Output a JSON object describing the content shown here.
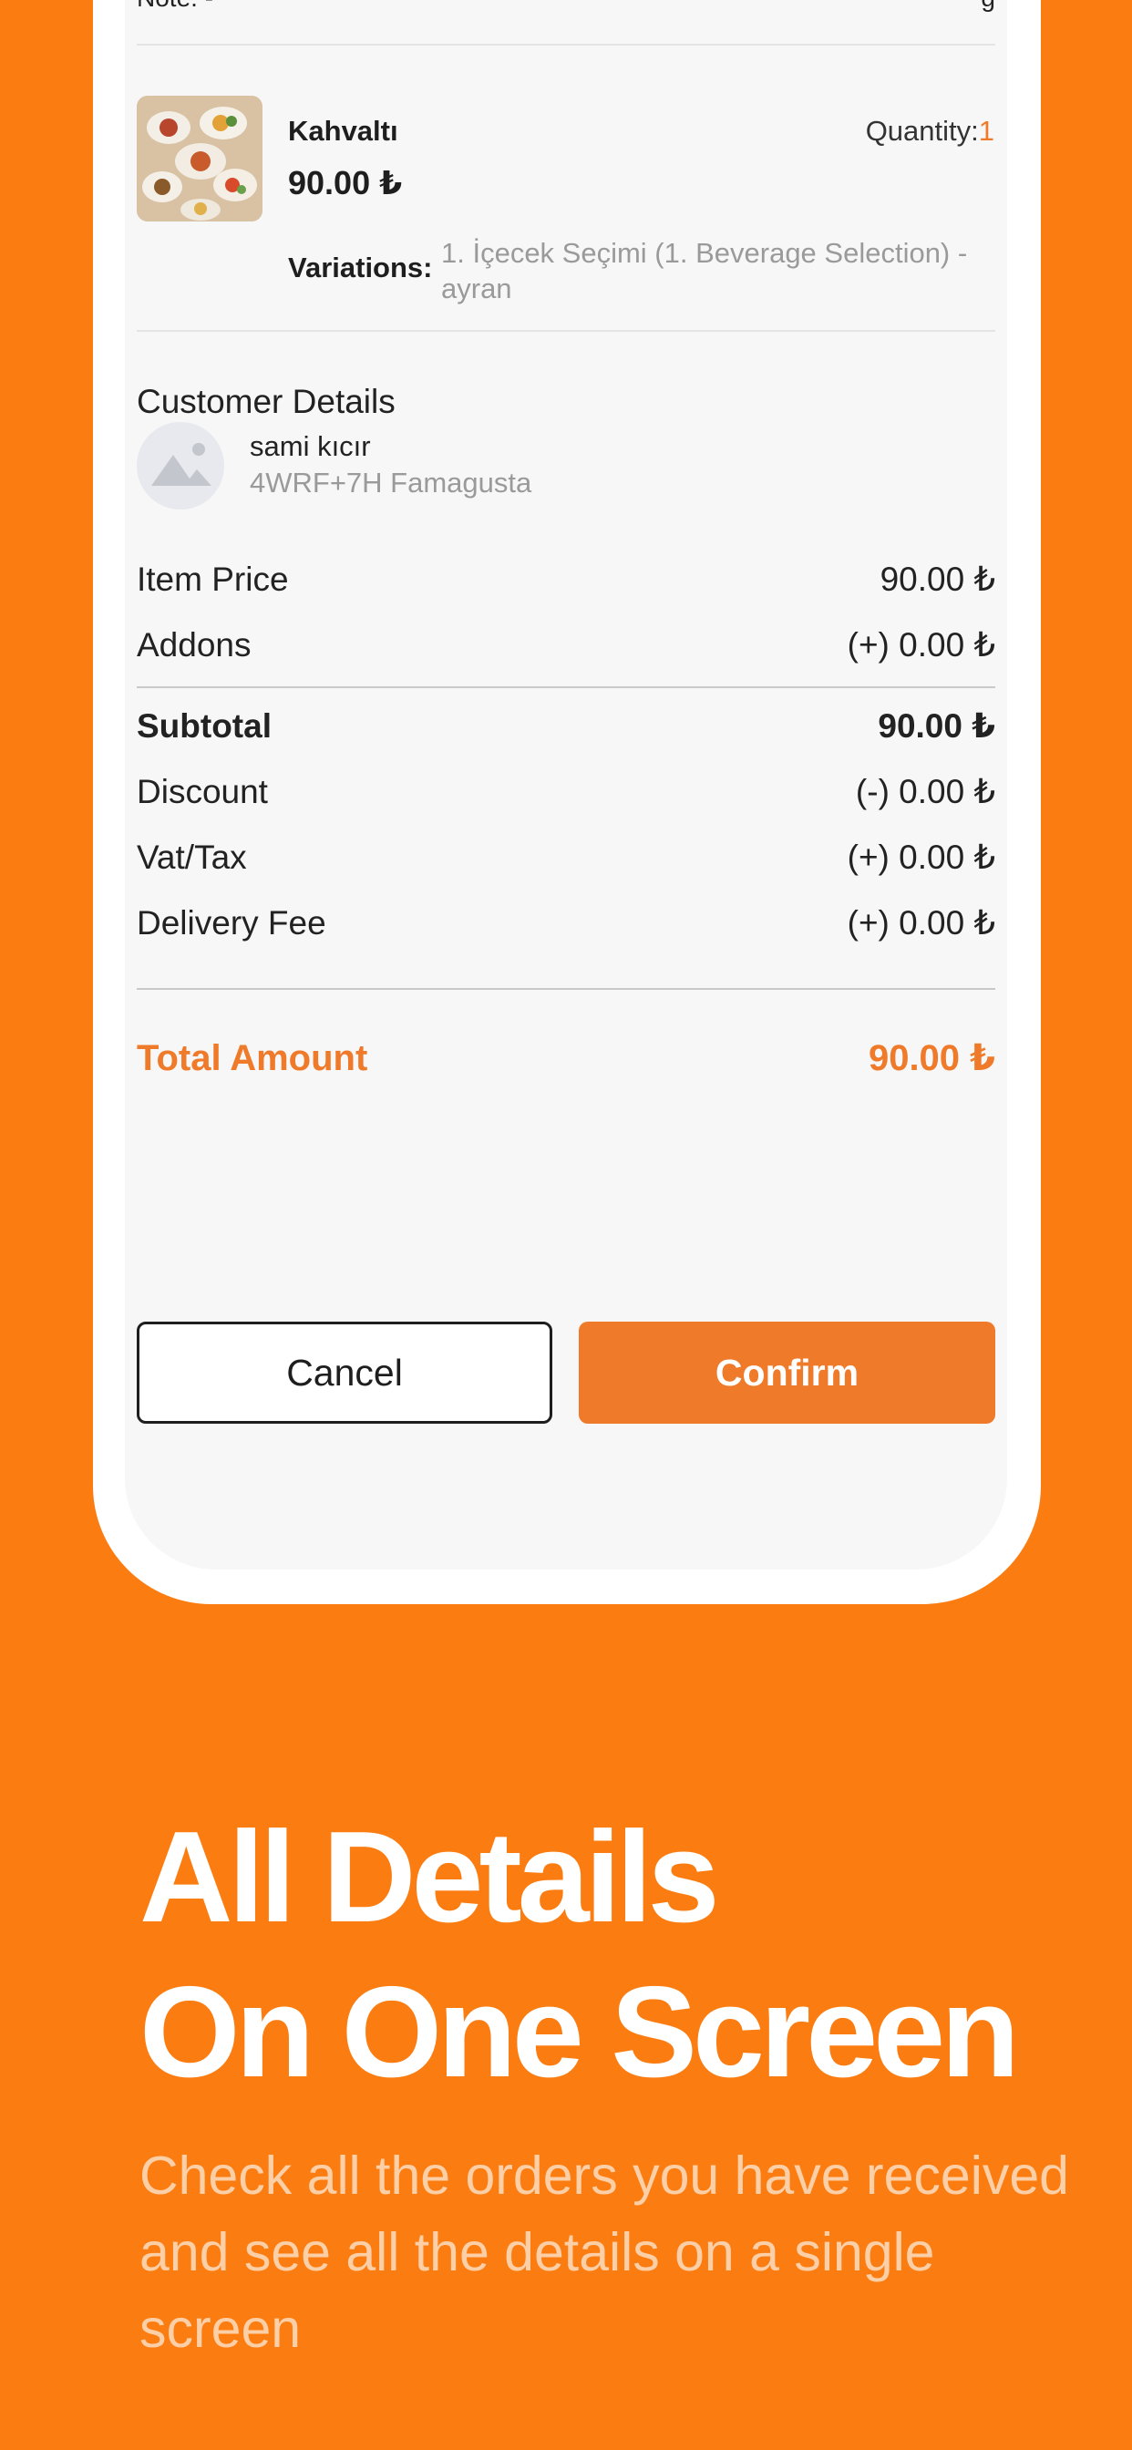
{
  "order": {
    "top_row_left": "Note: -",
    "top_row_right": "g",
    "item": {
      "name": "Kahvaltı",
      "price": "90.00 ₺",
      "quantity_label": "Quantity:",
      "quantity_value": "1",
      "variations_label": "Variations:",
      "variations_value": "1. İçecek Seçimi (1. Beverage Selection) - ayran"
    }
  },
  "customer": {
    "title": "Customer Details",
    "name": "sami kıcır",
    "address": "4WRF+7H Famagusta"
  },
  "pricing": {
    "item_price_label": "Item Price",
    "item_price_value": "90.00 ₺",
    "addons_label": "Addons",
    "addons_value": "(+) 0.00 ₺",
    "subtotal_label": "Subtotal",
    "subtotal_value": "90.00 ₺",
    "discount_label": "Discount",
    "discount_value": "(-) 0.00 ₺",
    "vat_label": "Vat/Tax",
    "vat_value": "(+) 0.00 ₺",
    "delivery_label": "Delivery Fee",
    "delivery_value": "(+) 0.00 ₺",
    "total_label": "Total Amount",
    "total_value": "90.00 ₺"
  },
  "actions": {
    "cancel_label": "Cancel",
    "confirm_label": "Confirm"
  },
  "marketing": {
    "headline_line1": "All Details",
    "headline_line2": "On One Screen",
    "subtext": "Check all the orders you have received and see all the details on a single screen"
  },
  "colors": {
    "background": "#FB7D12",
    "accent": "#EE7A2A",
    "subtext": "#FCCFA7"
  }
}
